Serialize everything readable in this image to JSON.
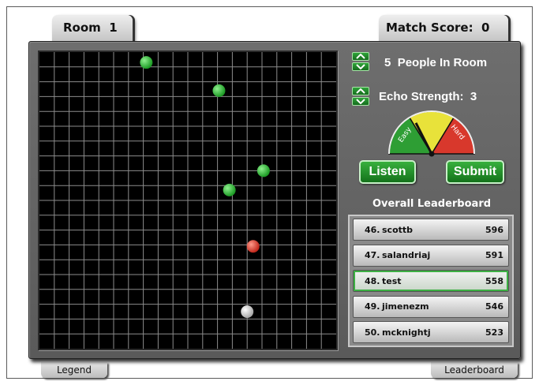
{
  "room_tab": {
    "label": "Room",
    "number": "1"
  },
  "score_tab": {
    "label": "Match Score:",
    "value": "0"
  },
  "people": {
    "count": "5",
    "label": "People In Room"
  },
  "echo": {
    "label": "Echo Strength:",
    "value": "3"
  },
  "gauge": {
    "easy_label": "Easy",
    "hard_label": "Hard",
    "level": 0.35
  },
  "buttons": {
    "listen": "Listen",
    "submit": "Submit"
  },
  "leaderboard": {
    "title": "Overall Leaderboard",
    "rows": [
      {
        "rank": "46.",
        "name": "scottb",
        "score": "596",
        "highlight": false
      },
      {
        "rank": "47.",
        "name": "salandriaj",
        "score": "591",
        "highlight": false
      },
      {
        "rank": "48.",
        "name": "test",
        "score": "558",
        "highlight": true
      },
      {
        "rank": "49.",
        "name": "jimenezm",
        "score": "546",
        "highlight": false
      },
      {
        "rank": "50.",
        "name": "mcknightj",
        "score": "523",
        "highlight": false
      }
    ]
  },
  "grid": {
    "cells": 20,
    "people_dots": [
      {
        "col": 7.2,
        "row": 0.7,
        "color": "green"
      },
      {
        "col": 12.1,
        "row": 2.6,
        "color": "green"
      },
      {
        "col": 15.1,
        "row": 8.0,
        "color": "green"
      },
      {
        "col": 12.8,
        "row": 9.3,
        "color": "green"
      },
      {
        "col": 14.4,
        "row": 13.1,
        "color": "red"
      },
      {
        "col": 14.0,
        "row": 17.5,
        "color": "white"
      }
    ]
  },
  "bottom_tabs": {
    "legend": "Legend",
    "leaderboard": "Leaderboard"
  },
  "colors": {
    "panel": "#666666",
    "accent_green": "#1f8a27",
    "grid_line": "#8c8c8c"
  }
}
